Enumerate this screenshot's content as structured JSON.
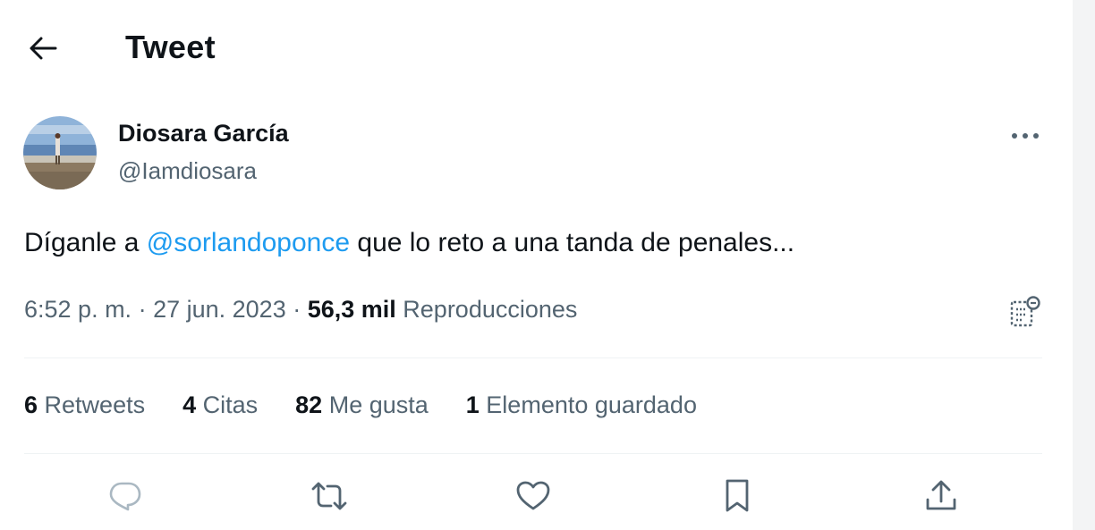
{
  "header": {
    "title": "Tweet"
  },
  "author": {
    "name": "Diosara García",
    "handle": "@Iamdiosara"
  },
  "tweet": {
    "text_before": "Díganle a ",
    "mention": "@sorlandoponce",
    "text_after": " que lo reto a una tanda de penales..."
  },
  "meta": {
    "time": "6:52 p. m.",
    "sep1": " · ",
    "date": "27 jun. 2023",
    "sep2": " · ",
    "views_count": "56,3 mil",
    "views_label": " Reproducciones"
  },
  "stats": [
    {
      "count": "6",
      "label": " Retweets"
    },
    {
      "count": "4",
      "label": " Citas"
    },
    {
      "count": "82",
      "label": " Me gusta"
    },
    {
      "count": "1",
      "label": " Elemento guardado"
    }
  ],
  "icons": {
    "back": "arrow-left-icon",
    "more": "more-horizontal-icon",
    "analytics": "analytics-icon",
    "reply": "reply-icon",
    "retweet": "retweet-icon",
    "like": "heart-icon",
    "bookmark": "bookmark-icon",
    "share": "share-icon"
  },
  "colors": {
    "text": "#0f1419",
    "secondary": "#536471",
    "link": "#1d9bf0",
    "divider": "#eff3f4"
  }
}
